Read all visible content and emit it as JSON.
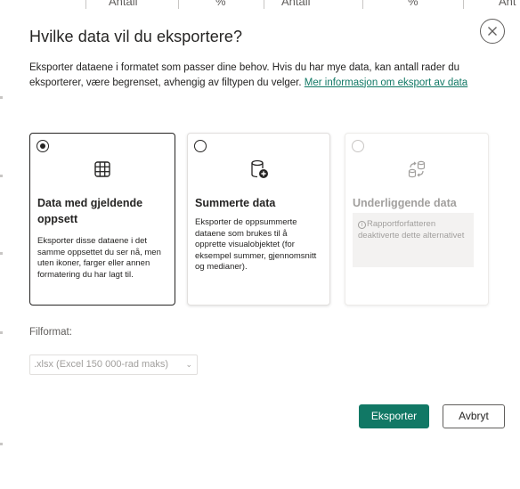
{
  "background": {
    "column_headers": [
      "Antall",
      "%",
      "Antall",
      "%",
      "Ant"
    ]
  },
  "dialog": {
    "title": "Hvilke data vil du eksportere?",
    "description": "Eksporter dataene i formatet som passer dine behov. Hvis du har mye data, kan antall rader du eksporterer, være begrenset, avhengig av filtypen du velger. ",
    "learn_more_link": "Mer informasjon om eksport av data",
    "close_icon": "close-icon"
  },
  "options": [
    {
      "title": "Data med gjeldende oppsett",
      "text": "Eksporter disse dataene i det samme oppsettet du ser nå, men uten ikoner, farger eller annen formatering du har lagt til.",
      "icon": "table-grid-icon",
      "selected": true,
      "disabled": false
    },
    {
      "title": "Summerte data",
      "text": "Eksporter de oppsummerte dataene som brukes til å opprette visualobjektet (for eksempel summer, gjennomsnitt og medianer).",
      "icon": "database-add-icon",
      "selected": false,
      "disabled": false
    },
    {
      "title": "Underliggende data",
      "notice": "Rapportforfatteren deaktiverte dette alternativet",
      "notice_icon": "info-icon",
      "icon": "database-sync-icon",
      "selected": false,
      "disabled": true
    }
  ],
  "file_format": {
    "label": "Filformat:",
    "selected": ".xlsx (Excel 150 000-rad maks)"
  },
  "buttons": {
    "export": "Eksporter",
    "cancel": "Avbryt"
  },
  "colors": {
    "accent": "#117865",
    "text": "#252423",
    "disabled_text": "#a19f9d"
  }
}
